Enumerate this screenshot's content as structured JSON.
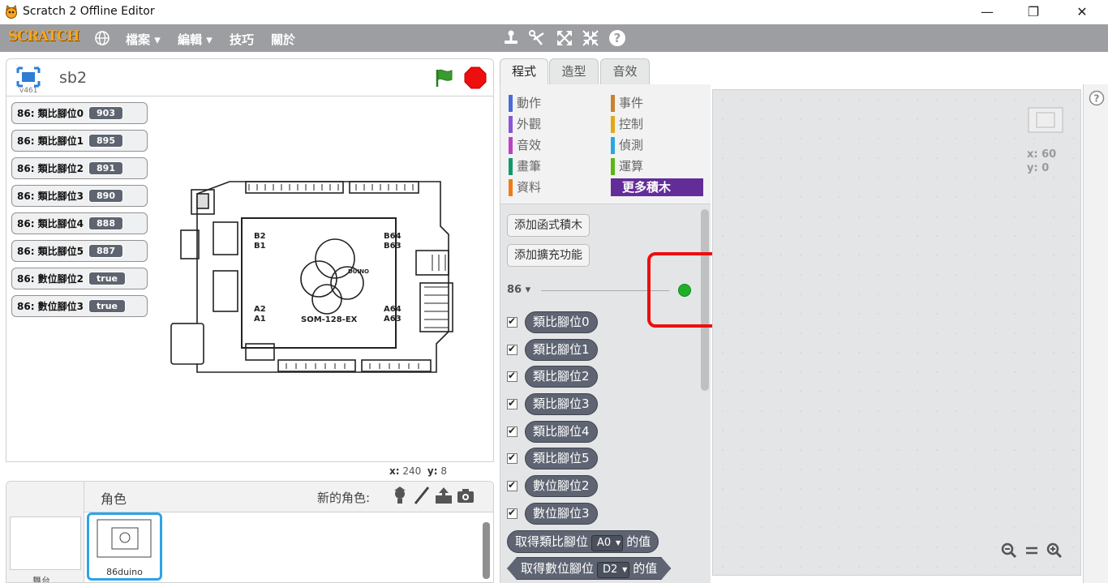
{
  "window": {
    "title": "Scratch 2 Offline Editor",
    "minimize": "—",
    "maximize": "❐",
    "close": "✕"
  },
  "menubar": {
    "logo": "SCRATCH",
    "items": [
      "檔案 ▾",
      "編輯 ▾",
      "技巧",
      "關於"
    ]
  },
  "stage": {
    "version": "v461",
    "project_name": "sb2",
    "coords": {
      "x_label": "x:",
      "x": "240",
      "y_label": "y:",
      "y": "8"
    }
  },
  "monitors": [
    {
      "label": "86: 類比腳位0",
      "value": "903"
    },
    {
      "label": "86: 類比腳位1",
      "value": "895"
    },
    {
      "label": "86: 類比腳位2",
      "value": "891"
    },
    {
      "label": "86: 類比腳位3",
      "value": "890"
    },
    {
      "label": "86: 類比腳位4",
      "value": "888"
    },
    {
      "label": "86: 類比腳位5",
      "value": "887"
    },
    {
      "label": "86: 數位腳位2",
      "value": "true"
    },
    {
      "label": "86: 數位腳位3",
      "value": "true"
    }
  ],
  "board": {
    "labels": {
      "b2": "B2",
      "b1": "B1",
      "b64": "B64",
      "b63": "B63",
      "a2": "A2",
      "a1": "A1",
      "a64": "A64",
      "a63": "A63",
      "chip": "SOM-128-EX",
      "logo": "DUINO"
    }
  },
  "sprites": {
    "title": "角色",
    "new_sprite": "新的角色:",
    "stage_label": "舞台",
    "sprite_name": "86duino"
  },
  "tabs": [
    "程式",
    "造型",
    "音效"
  ],
  "categories": [
    {
      "label": "動作",
      "color": "#4a6cd4"
    },
    {
      "label": "事件",
      "color": "#c88330"
    },
    {
      "label": "外觀",
      "color": "#8a55d7"
    },
    {
      "label": "控制",
      "color": "#e1a91a"
    },
    {
      "label": "音效",
      "color": "#bb42c3"
    },
    {
      "label": "偵測",
      "color": "#2ca5e2"
    },
    {
      "label": "畫筆",
      "color": "#0e9a6c"
    },
    {
      "label": "運算",
      "color": "#5cb712"
    },
    {
      "label": "資料",
      "color": "#ee7d16"
    },
    {
      "label": "更多積木",
      "color": "#632d99"
    }
  ],
  "palette": {
    "add_block": "添加函式積木",
    "add_extension": "添加擴充功能",
    "extension_name": "86 ▾",
    "reporters": [
      "類比腳位0",
      "類比腳位1",
      "類比腳位2",
      "類比腳位3",
      "類比腳位4",
      "類比腳位5",
      "數位腳位2",
      "數位腳位3"
    ],
    "block_analog": {
      "pre": "取得類比腳位",
      "pin": "A0",
      "post": "的值"
    },
    "block_digital": {
      "pre": "取得數位腳位",
      "pin": "D2",
      "post": "的值"
    }
  },
  "scripts": {
    "x_label": "x: 60",
    "y_label": "y: 0"
  }
}
